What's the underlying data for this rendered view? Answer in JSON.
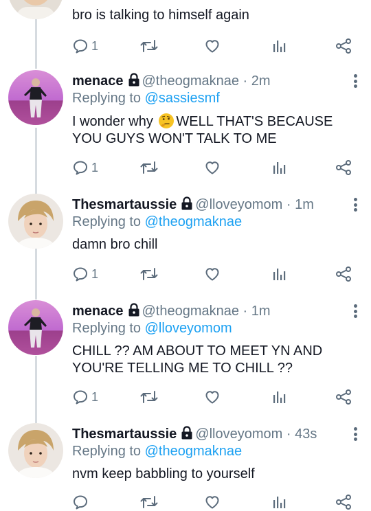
{
  "first_tweet_text": "bro is talking to himself again",
  "first_tweet_reply_count": "1",
  "tweets": [
    {
      "name": "menace",
      "handle_time": "@theogmaknae · 2m",
      "replying_prefix": "Replying to",
      "replying_to": "@sassiesmf",
      "text_before_emoji": "I wonder why",
      "emoji": "thinking-face",
      "text_after_emoji": "WELL THAT'S BECAUSE YOU GUYS WON'T TALK TO ME",
      "reply_count": "1"
    },
    {
      "name": "Thesmartaussie",
      "handle_time": "@lloveyomom · 1m",
      "replying_prefix": "Replying to",
      "replying_to": "@theogmaknae",
      "text": "damn bro chill",
      "reply_count": "1"
    },
    {
      "name": "menace",
      "handle_time": "@theogmaknae · 1m",
      "replying_prefix": "Replying to",
      "replying_to": "@lloveyomom",
      "text": "CHILL ?? AM ABOUT TO MEET YN AND YOU'RE TELLING ME TO CHILL ??",
      "reply_count": "1"
    },
    {
      "name": "Thesmartaussie",
      "handle_time": "@lloveyomom · 43s",
      "replying_prefix": "Replying to",
      "replying_to": "@theogmaknae",
      "text": "nvm keep babbling to yourself",
      "reply_count": ""
    }
  ],
  "icons": {
    "reply": "reply-icon",
    "retweet": "retweet-icon",
    "like": "heart-icon",
    "stats": "stats-icon",
    "share": "share-icon",
    "lock": "lock-icon",
    "more": "more-vertical-icon"
  },
  "colors": {
    "mention": "#1da1f2",
    "secondary_text": "#657786",
    "thread_line": "#d6dbe0"
  }
}
